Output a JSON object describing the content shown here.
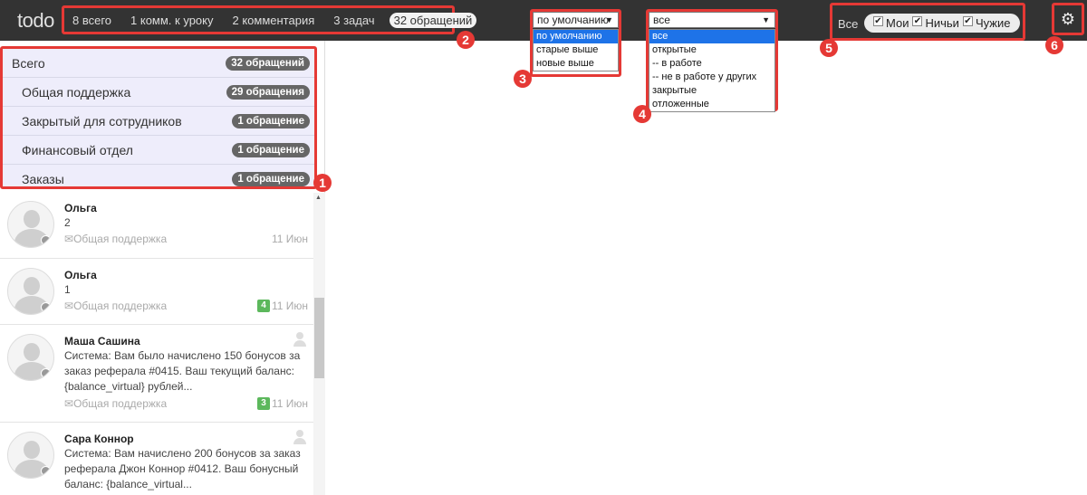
{
  "app": {
    "logo": "todo"
  },
  "tabs": [
    {
      "label": "8 всего"
    },
    {
      "label": "1 комм. к уроку"
    },
    {
      "label": "2 комментария"
    },
    {
      "label": "3 задач"
    },
    {
      "label": "32 обращений",
      "active": true
    }
  ],
  "sort": {
    "selected": "по умолчанию",
    "options": [
      "по умолчанию",
      "старые выше",
      "новые выше"
    ]
  },
  "status": {
    "selected": "все",
    "options": [
      "все",
      "открытые",
      "-- в работе",
      "-- не в работе у других",
      "закрытые",
      "отложенные"
    ]
  },
  "filter": {
    "all_label": "Все",
    "checks": [
      {
        "label": "Мои",
        "checked": true
      },
      {
        "label": "Ничьи",
        "checked": true
      },
      {
        "label": "Чужие",
        "checked": true
      }
    ]
  },
  "callouts": [
    "1",
    "2",
    "3",
    "4",
    "5",
    "6"
  ],
  "categories": [
    {
      "name": "Всего",
      "count": "32 обращений"
    },
    {
      "name": "Общая поддержка",
      "count": "29 обращения"
    },
    {
      "name": "Закрытый для сотрудников",
      "count": "1 обращение"
    },
    {
      "name": "Финансовый отдел",
      "count": "1 обращение"
    },
    {
      "name": "Заказы",
      "count": "1 обращение"
    }
  ],
  "items": [
    {
      "name": "Ольга",
      "text": "2",
      "dept": "Общая поддержка",
      "date": "11 Июн"
    },
    {
      "name": "Ольга",
      "text": "1",
      "dept": "Общая поддержка",
      "date": "11 Июн",
      "badge": "4"
    },
    {
      "name": "Маша Сашина",
      "text": "Система: Вам было начислено 150 бонусов за заказ реферала #0415. Ваш текущий баланс: {balance_virtual} рублей...",
      "dept": "Общая поддержка",
      "date": "11 Июн",
      "badge": "3"
    },
    {
      "name": "Сара Коннор",
      "text": "Система: Вам начислено 200 бонусов за заказ реферала Джон Коннор #0412. Ваш бонусный баланс: {balance_virtual..."
    }
  ],
  "colors": {
    "topbar": "#333333",
    "callout": "#e53935",
    "category_bg": "#eeedfb",
    "highlight": "#1e73e8",
    "badge_green": "#5cb85c"
  }
}
